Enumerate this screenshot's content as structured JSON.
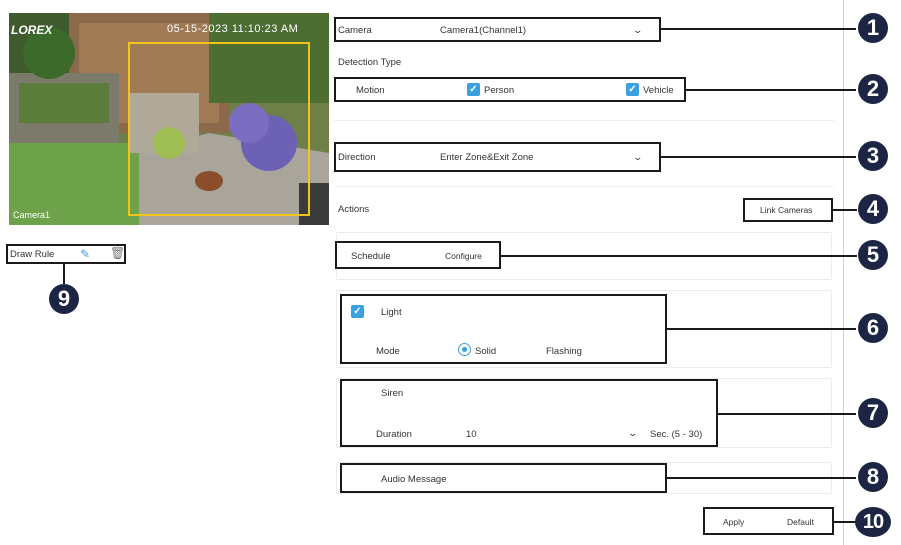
{
  "video": {
    "logo": "LOREX",
    "timestamp": "05-15-2023 11:10:23 AM",
    "camera_label": "Camera1"
  },
  "draw_rule": {
    "label": "Draw Rule"
  },
  "camera": {
    "label": "Camera",
    "value": "Camera1(Channel1)"
  },
  "detection_type": {
    "label": "Detection Type",
    "motion": "Motion",
    "person": "Person",
    "vehicle": "Vehicle"
  },
  "direction": {
    "label": "Direction",
    "value": "Enter Zone&Exit Zone"
  },
  "actions": {
    "label": "Actions",
    "link_cameras": "Link Cameras"
  },
  "schedule": {
    "label": "Schedule",
    "configure": "Configure"
  },
  "light": {
    "label": "Light",
    "mode_label": "Mode",
    "solid": "Solid",
    "flashing": "Flashing"
  },
  "siren": {
    "label": "Siren",
    "duration_label": "Duration",
    "duration_value": "10",
    "duration_unit": "Sec. (5 - 30)"
  },
  "audio": {
    "label": "Audio Message"
  },
  "footer": {
    "apply": "Apply",
    "default": "Default"
  },
  "callouts": [
    "1",
    "2",
    "3",
    "4",
    "5",
    "6",
    "7",
    "8",
    "9",
    "10"
  ],
  "colors": {
    "callout": "#1c2544",
    "checkbox": "#3aa0e0",
    "zone": "#f0c419"
  }
}
